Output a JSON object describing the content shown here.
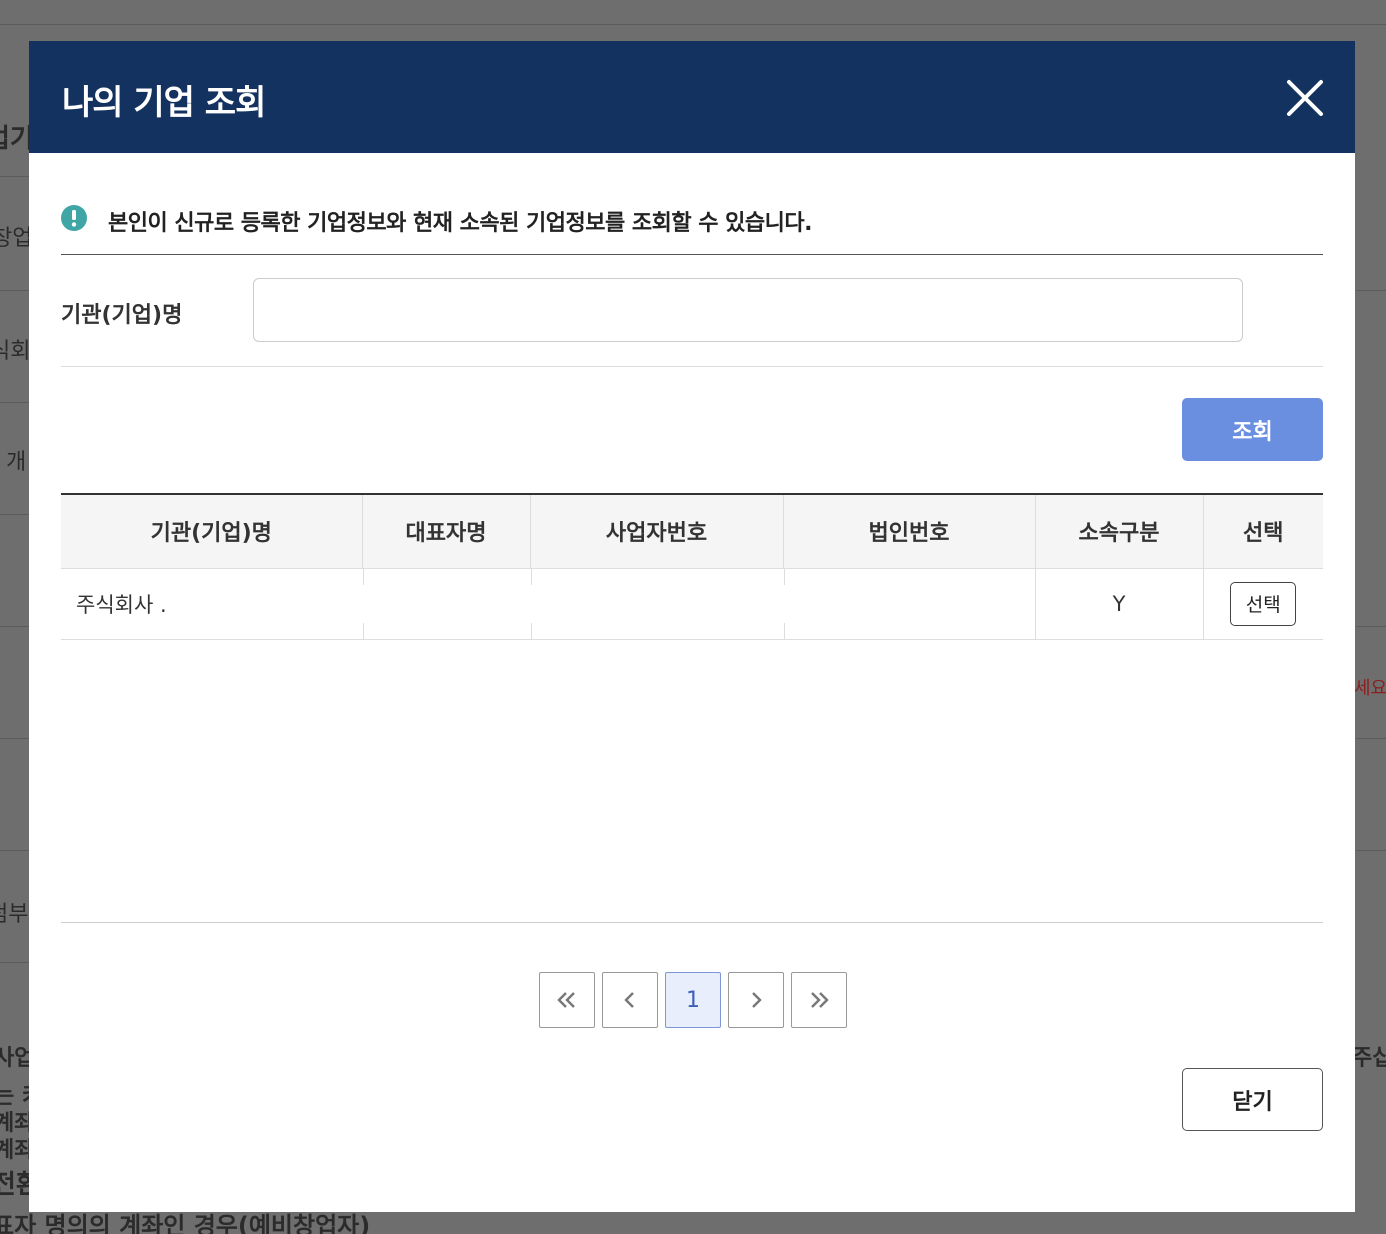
{
  "modal": {
    "title": "나의 기업 조회",
    "notice": "본인이 신규로 등록한 기업정보와 현재 소속된 기업정보를 조회할 수 있습니다.",
    "search": {
      "label": "기관(기업)명",
      "value": "",
      "placeholder": ""
    },
    "query_button": "조회",
    "table": {
      "headers": [
        "기관(기업)명",
        "대표자명",
        "사업자번호",
        "법인번호",
        "소속구분",
        "선택"
      ],
      "rows": [
        {
          "name": "주식회사 .",
          "ceo": "",
          "biz_no": "",
          "corp_no": "",
          "affiliation": "Y",
          "select_label": "선택"
        }
      ]
    },
    "pagination": {
      "current_page": "1"
    },
    "close_button": "닫기"
  },
  "background": {
    "fragments": [
      "업기",
      "창업",
      "식회",
      "개",
      "세요",
      "첨부",
      "사업",
      "는 키",
      "계좌",
      "계좌",
      "전환",
      "표자 명의의 계좌인 경우(예비창업자)",
      "주십"
    ]
  },
  "colors": {
    "header_bg": "#14325f",
    "primary_button": "#6b8fe0",
    "notice_icon": "#3fa5a5"
  }
}
